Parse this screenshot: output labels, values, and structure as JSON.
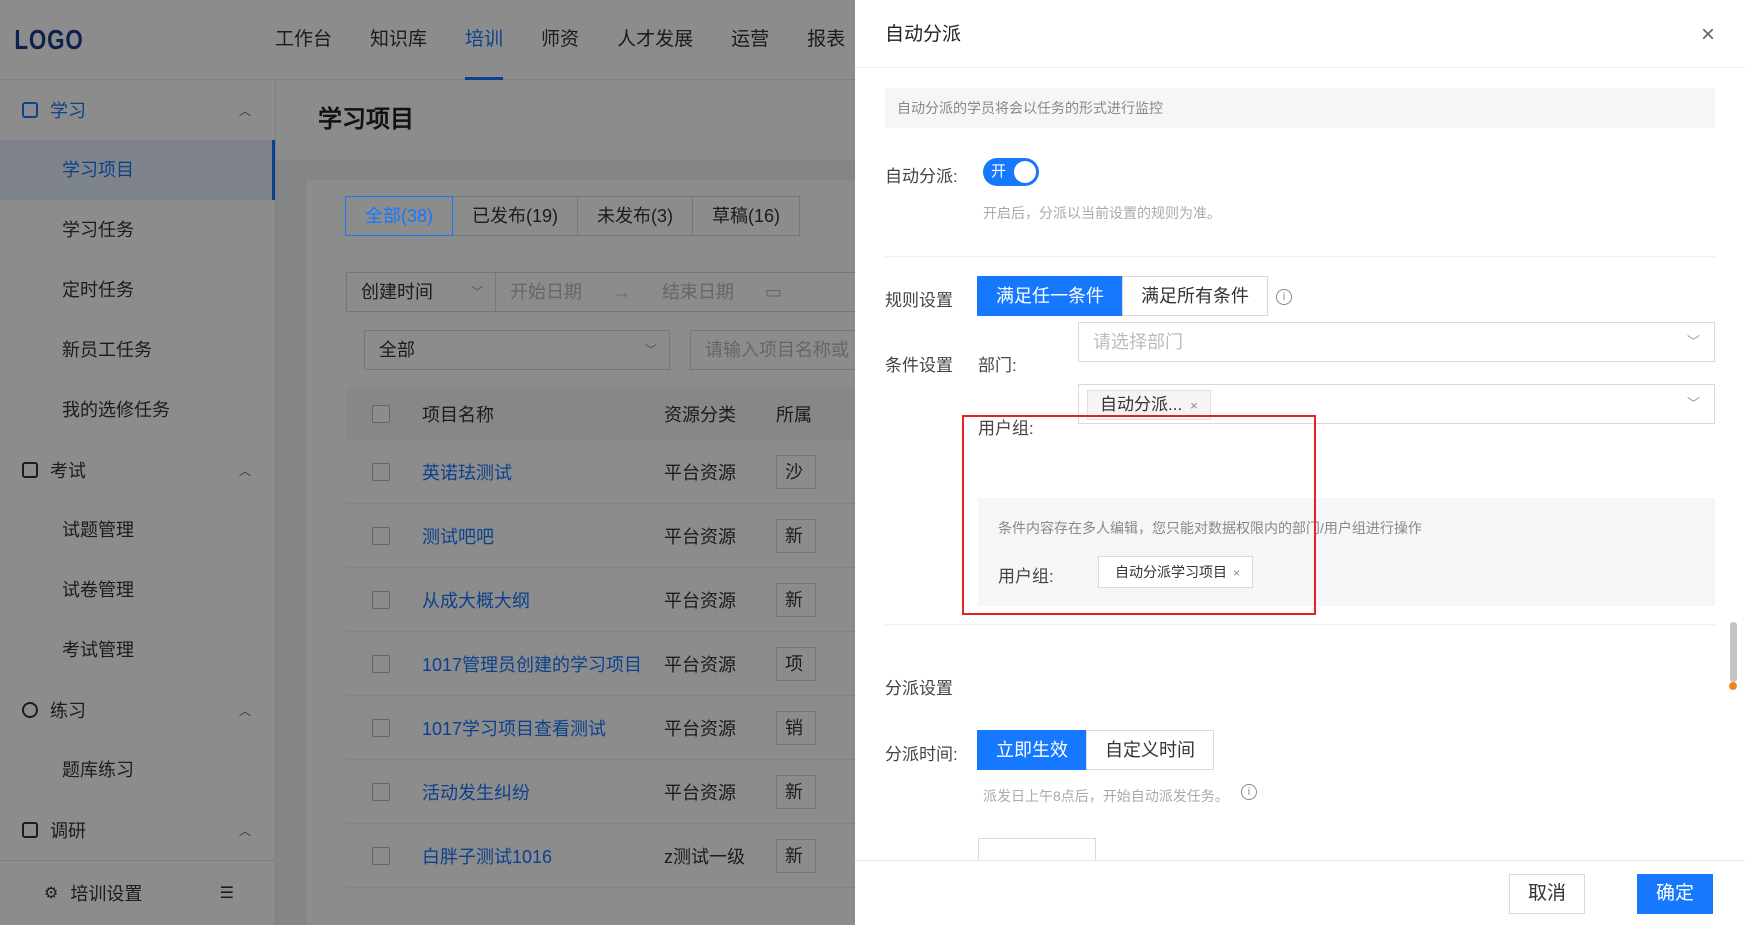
{
  "app": {
    "logo": "LOGO"
  },
  "nav": [
    {
      "label": "工作台",
      "active": false
    },
    {
      "label": "知识库",
      "active": false
    },
    {
      "label": "培训",
      "active": true
    },
    {
      "label": "师资",
      "active": false
    },
    {
      "label": "人才发展",
      "active": false
    },
    {
      "label": "运营",
      "active": false
    },
    {
      "label": "报表",
      "active": false
    }
  ],
  "sidebar": {
    "groups": [
      {
        "label": "学习",
        "icon": "book-icon",
        "items": [
          "学习项目",
          "学习任务",
          "定时任务",
          "新员工任务",
          "我的选修任务"
        ]
      },
      {
        "label": "考试",
        "icon": "exam-icon",
        "items": [
          "试题管理",
          "试卷管理",
          "考试管理"
        ]
      },
      {
        "label": "练习",
        "icon": "practice-icon",
        "items": [
          "题库练习"
        ]
      },
      {
        "label": "调研",
        "icon": "survey-icon",
        "items": []
      }
    ],
    "footer": "培训设置"
  },
  "main": {
    "title": "学习项目",
    "tabs": [
      "全部(38)",
      "已发布(19)",
      "未发布(3)",
      "草稿(16)"
    ],
    "filter": {
      "time_type": "创建时间",
      "start_placeholder": "开始日期",
      "end_placeholder": "结束日期",
      "status": "全部",
      "search_placeholder": "请输入项目名称或"
    },
    "table": {
      "headers": [
        "项目名称",
        "资源分类",
        "所属"
      ],
      "rows": [
        {
          "name": "英诺珐测试",
          "src": "平台资源",
          "own": "沙"
        },
        {
          "name": "测试吧吧",
          "src": "平台资源",
          "own": "新"
        },
        {
          "name": "从成大概大纲",
          "src": "平台资源",
          "own": "新"
        },
        {
          "name": "1017管理员创建的学习项目",
          "src": "平台资源",
          "own": "项"
        },
        {
          "name": "1017学习项目查看测试",
          "src": "平台资源",
          "own": "销"
        },
        {
          "name": "活动发生纠纷",
          "src": "平台资源",
          "own": "新"
        },
        {
          "name": "白胖子测试1016",
          "src": "z测试一级",
          "own": "新"
        }
      ]
    }
  },
  "drawer": {
    "title": "自动分派",
    "notice": "自动分派的学员将会以任务的形式进行监控",
    "auto_label": "自动分派:",
    "toggle_text": "开",
    "auto_hint": "开启后，分派以当前设置的规则为准。",
    "rule_label": "规则设置",
    "rule_options": [
      "满足任一条件",
      "满足所有条件"
    ],
    "condition_label": "条件设置",
    "dept_label": "部门:",
    "dept_placeholder": "请选择部门",
    "group_label": "用户组:",
    "group_tag": "自动分派...",
    "multi_edit_notice": "条件内容存在多人编辑，您只能对数据权限内的部门/用户组进行操作",
    "readonly_group_label": "用户组:",
    "readonly_group_tag": "自动分派学习项目",
    "dispatch_section": "分派设置",
    "dispatch_time_label": "分派时间:",
    "dispatch_options": [
      "立即生效",
      "自定义时间"
    ],
    "dispatch_hint": "派发日上午8点后，开始自动派发任务。",
    "cancel": "取消",
    "ok": "确定"
  },
  "colors": {
    "primary": "#1677ff",
    "highlight": "#e82020"
  }
}
